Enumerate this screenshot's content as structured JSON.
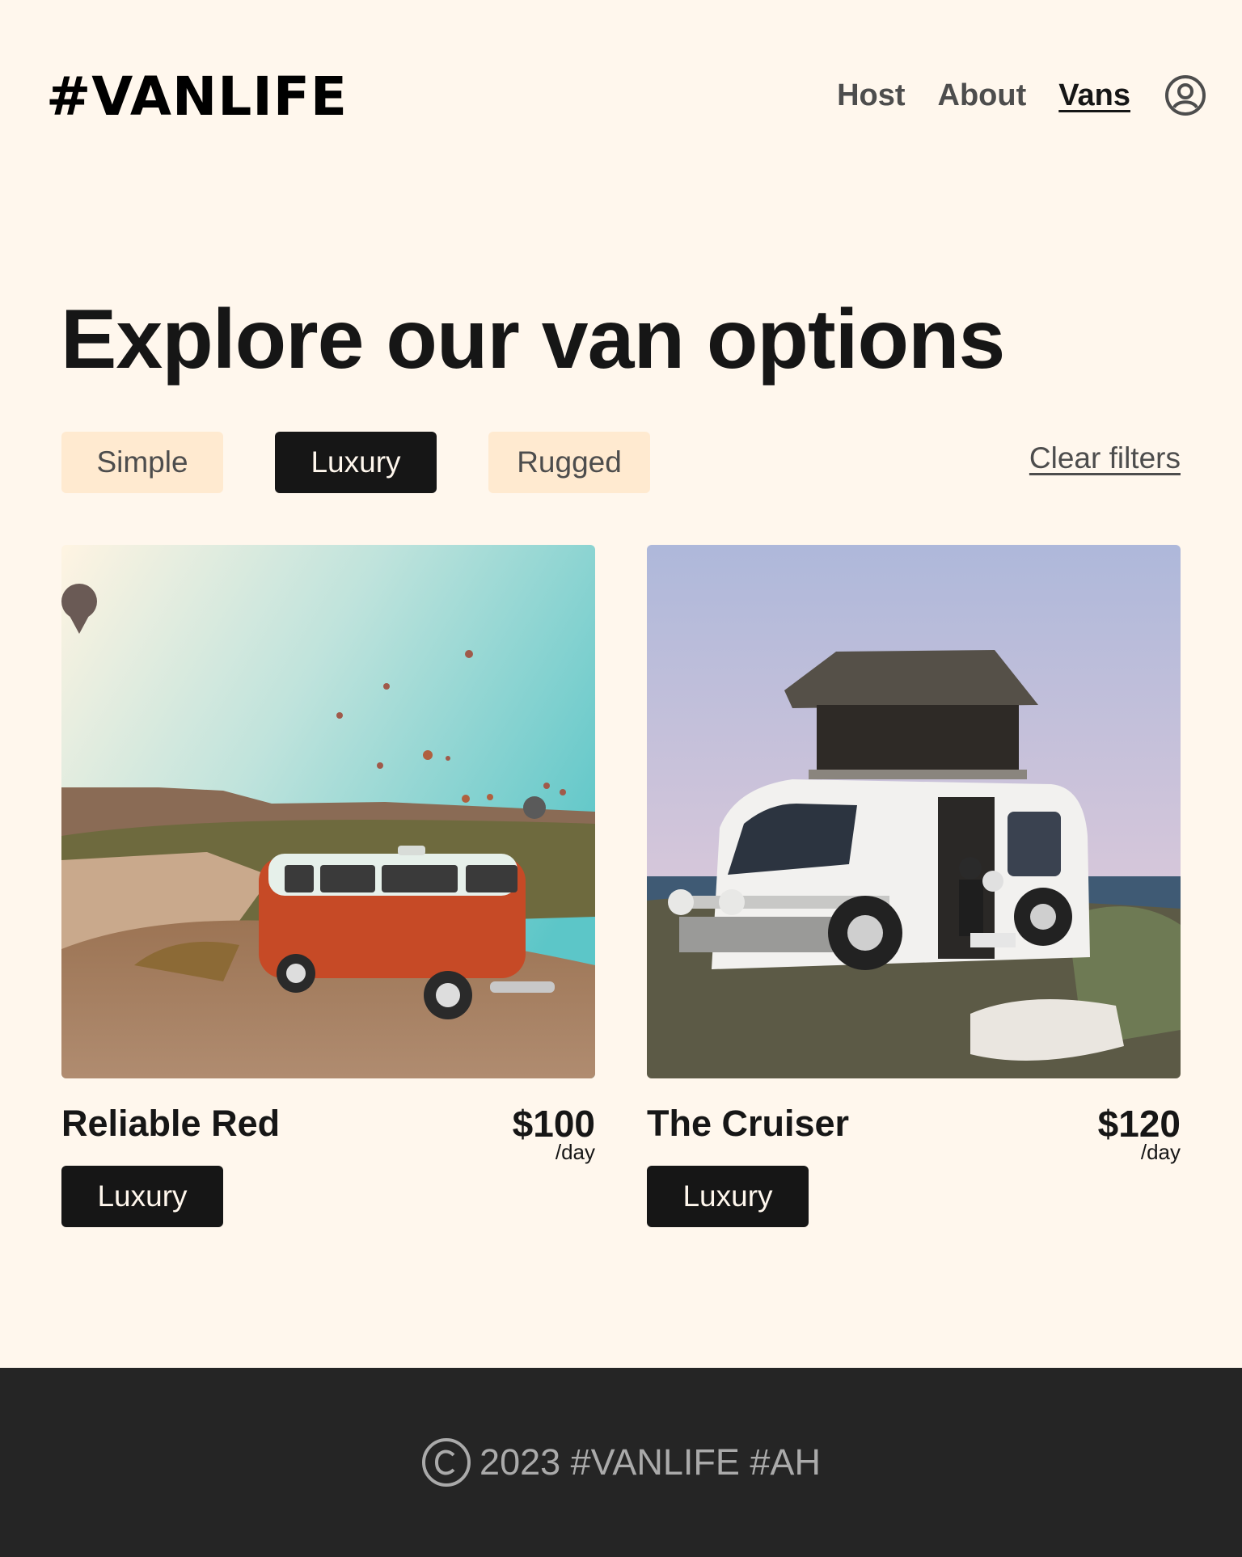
{
  "header": {
    "logo": "#VANLIFE",
    "nav": [
      {
        "label": "Host",
        "active": false
      },
      {
        "label": "About",
        "active": false
      },
      {
        "label": "Vans",
        "active": true
      }
    ],
    "account_icon": "user-circle-icon"
  },
  "main": {
    "title": "Explore our van options",
    "filters": [
      {
        "label": "Simple",
        "active": false
      },
      {
        "label": "Luxury",
        "active": true
      },
      {
        "label": "Rugged",
        "active": false
      }
    ],
    "clear_label": "Clear filters",
    "vans": [
      {
        "name": "Reliable Red",
        "price": "$100",
        "per": "/day",
        "type": "Luxury"
      },
      {
        "name": "The Cruiser",
        "price": "$120",
        "per": "/day",
        "type": "Luxury"
      }
    ]
  },
  "footer": {
    "text": "2023 #VANLIFE #AH",
    "icon": "copyright-icon"
  },
  "colors": {
    "background": "#FFF7ED",
    "filter_inactive": "#FFEAD0",
    "dark": "#161616",
    "footer_bg": "#252525",
    "footer_text": "#AAAAAA"
  }
}
